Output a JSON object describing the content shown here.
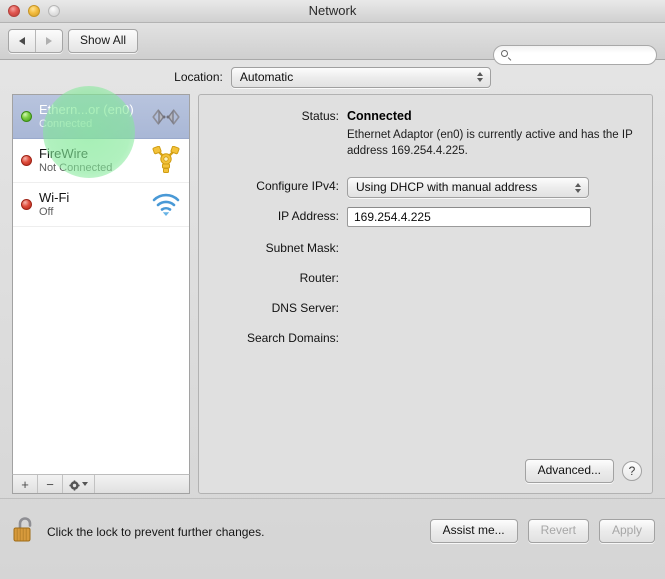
{
  "window": {
    "title": "Network",
    "traffic_lights": [
      "close",
      "minimize",
      "zoom"
    ]
  },
  "toolbar": {
    "back_icon": "triangle-left-icon",
    "forward_icon": "triangle-right-icon",
    "show_all_label": "Show All",
    "search": {
      "value": "",
      "placeholder": "",
      "icon": "search-icon"
    }
  },
  "location": {
    "label": "Location:",
    "selected": "Automatic",
    "options": [
      "Automatic"
    ]
  },
  "sidebar": {
    "interfaces": [
      {
        "name": "Ethern...or (en0)",
        "status": "Connected",
        "state_color": "#6cc32c",
        "state": "green",
        "icon": "ethernet-icon",
        "selected": true
      },
      {
        "name": "FireWire",
        "status": "Not Connected",
        "state_color": "#d64433",
        "state": "red",
        "icon": "firewire-icon",
        "selected": false
      },
      {
        "name": "Wi-Fi",
        "status": "Off",
        "state_color": "#d64433",
        "state": "red",
        "icon": "wifi-icon",
        "selected": false
      }
    ],
    "toolbar": {
      "add_label": "+",
      "remove_label": "−",
      "action_icon": "gear-icon"
    }
  },
  "main": {
    "status": {
      "label": "Status:",
      "value": "Connected",
      "description": "Ethernet Adaptor (en0) is currently active and has the IP address 169.254.4.225."
    },
    "configure_ipv4": {
      "label": "Configure IPv4:",
      "selected": "Using DHCP with manual address",
      "options": [
        "Using DHCP with manual address"
      ]
    },
    "ip_address": {
      "label": "IP Address:",
      "value": "169.254.4.225",
      "placeholder": ""
    },
    "subnet_mask": {
      "label": "Subnet Mask:",
      "value": ""
    },
    "router": {
      "label": "Router:",
      "value": ""
    },
    "dns_server": {
      "label": "DNS Server:",
      "value": ""
    },
    "search_domains": {
      "label": "Search Domains:",
      "value": ""
    },
    "advanced_label": "Advanced...",
    "help_label": "?"
  },
  "footer": {
    "lock_icon": "unlocked-padlock-icon",
    "lock_text": "Click the lock to prevent further changes.",
    "assist_label": "Assist me...",
    "revert_label": "Revert",
    "apply_label": "Apply",
    "revert_enabled": false,
    "apply_enabled": false
  },
  "overlay": {
    "click_highlight_color": "#80e896"
  }
}
